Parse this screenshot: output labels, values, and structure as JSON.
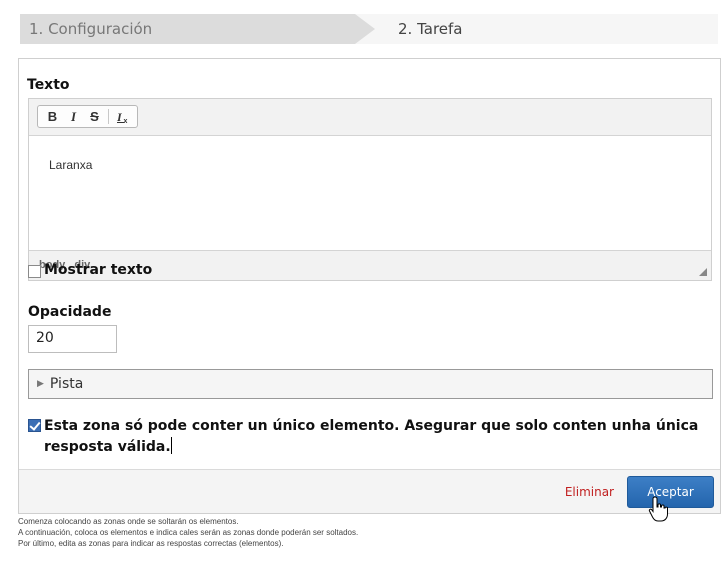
{
  "steps": {
    "step1": "1. Configuración",
    "step2": "2. Tarefa"
  },
  "texto_label": "Texto",
  "editor": {
    "toolbar": {
      "bold": "B",
      "italic": "I",
      "strike": "S",
      "clear": "Ix"
    },
    "content": "Laranxa",
    "path": [
      "body",
      "div"
    ]
  },
  "mostrar_texto": {
    "label": "Mostrar texto",
    "checked": false
  },
  "opacidade": {
    "label": "Opacidade",
    "value": "20"
  },
  "pista": {
    "label": "Pista"
  },
  "single_zone": {
    "label": "Esta zona só pode conter un único elemento. Asegurar que solo conten unha única resposta válida.",
    "checked": true
  },
  "footer": {
    "delete": "Eliminar",
    "accept": "Aceptar"
  },
  "info": [
    "Comenza colocando as zonas onde se soltarán os elementos.",
    "A continuación, coloca os elementos e indica cales serán as zonas donde poderán ser soltados.",
    "Por último, edita as zonas para indicar as respostas correctas (elementos)."
  ],
  "colors": {
    "accent": "#2a6ab3",
    "danger": "#c12121"
  }
}
